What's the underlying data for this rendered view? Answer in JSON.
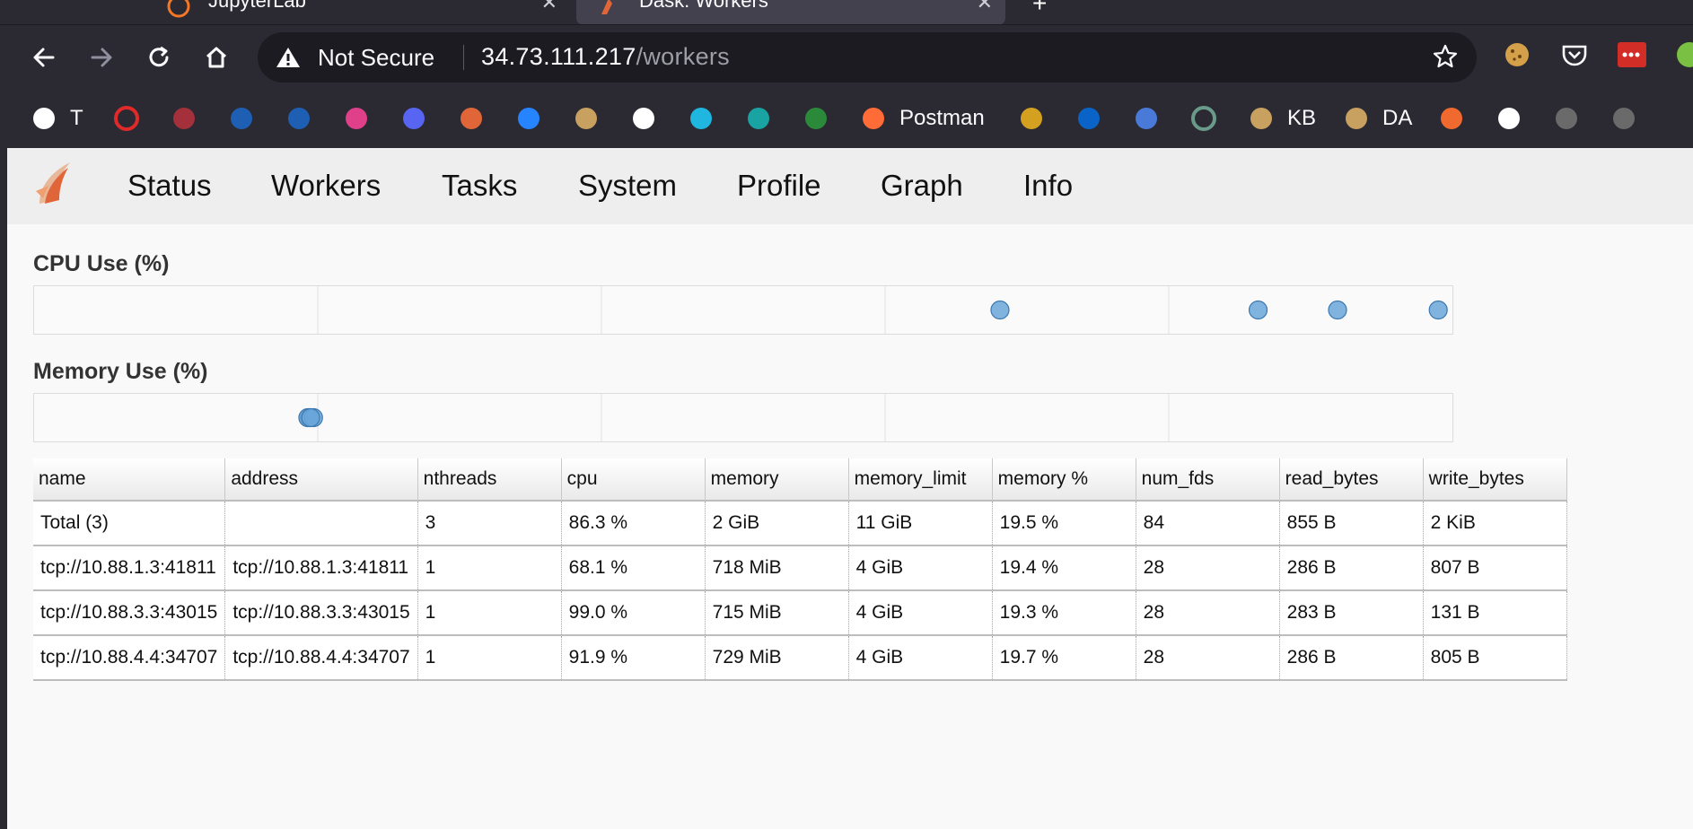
{
  "browser": {
    "tabs": [
      {
        "label": "JupyterLab",
        "close": "✕"
      },
      {
        "label": "Dask: Workers",
        "close": "✕"
      }
    ],
    "new_tab": "+",
    "security": "Not Secure",
    "url_host": "34.73.111.217",
    "url_path": "/workers",
    "bookmarks": [
      {
        "icon": "globe-icon",
        "label": "T",
        "color": "#ffffff"
      },
      {
        "icon": "gear-red-icon",
        "label": "",
        "color": "#e02a2a"
      },
      {
        "icon": "shield-crest-icon",
        "label": "",
        "color": "#a3303a"
      },
      {
        "icon": "ribbon-blue-icon",
        "label": "",
        "color": "#1e5fb3"
      },
      {
        "icon": "ribbon-blue-icon",
        "label": "",
        "color": "#1e5fb3"
      },
      {
        "icon": "heart-icon",
        "label": "",
        "color": "#e0408a"
      },
      {
        "icon": "discord-icon",
        "label": "",
        "color": "#5865f2"
      },
      {
        "icon": "dask-leaf-icon",
        "label": "",
        "color": "#e0663a"
      },
      {
        "icon": "confluence-icon",
        "label": "",
        "color": "#2684ff"
      },
      {
        "icon": "arrow-flag-icon",
        "label": "",
        "color": "#c8a060"
      },
      {
        "icon": "github-icon",
        "label": "",
        "color": "#ffffff"
      },
      {
        "icon": "circle-cyan-icon",
        "label": "",
        "color": "#1fb6e0"
      },
      {
        "icon": "eye-teal-icon",
        "label": "",
        "color": "#1aa3a3"
      },
      {
        "icon": "chart-green-icon",
        "label": "",
        "color": "#2a8a3a"
      },
      {
        "icon": "postman-icon",
        "label": "Postman",
        "color": "#ff6c37"
      },
      {
        "icon": "letter-j-icon",
        "label": "",
        "color": "#d4a020"
      },
      {
        "icon": "outlook-icon",
        "label": "",
        "color": "#0a64c8"
      },
      {
        "icon": "lock-box-icon",
        "label": "",
        "color": "#4a7ad8"
      },
      {
        "icon": "ring-green-icon",
        "label": "",
        "color": "#6a9a8a"
      },
      {
        "icon": "arrow-flag-icon",
        "label": "KB",
        "color": "#c8a060"
      },
      {
        "icon": "arrow-flag-icon",
        "label": "DA",
        "color": "#c8a060"
      },
      {
        "icon": "blocks-orange-icon",
        "label": "",
        "color": "#f06a30"
      },
      {
        "icon": "github-icon",
        "label": "",
        "color": "#ffffff"
      },
      {
        "icon": "github-icon",
        "label": "",
        "color": "#6a6a6a"
      },
      {
        "icon": "github-icon",
        "label": "",
        "color": "#6a6a6a"
      }
    ]
  },
  "dask": {
    "nav": [
      "Status",
      "Workers",
      "Tasks",
      "System",
      "Profile",
      "Graph",
      "Info"
    ],
    "cpu_title": "CPU Use (%)",
    "mem_title": "Memory Use (%)",
    "accent": "#6aa6d8"
  },
  "chart_data": [
    {
      "type": "scatter",
      "title": "CPU Use (%)",
      "xlabel": "",
      "ylabel": "",
      "xlim": [
        0,
        100
      ],
      "grid": true,
      "values": [
        68.1,
        91.9,
        99.0,
        86.3
      ]
    },
    {
      "type": "scatter",
      "title": "Memory Use (%)",
      "xlabel": "",
      "ylabel": "",
      "xlim": [
        0,
        100
      ],
      "grid": true,
      "values": [
        19.4,
        19.3,
        19.7,
        19.5
      ]
    }
  ],
  "table": {
    "columns": [
      "name",
      "address",
      "nthreads",
      "cpu",
      "memory",
      "memory_limit",
      "memory %",
      "num_fds",
      "read_bytes",
      "write_bytes"
    ],
    "rows": [
      [
        "Total (3)",
        "",
        "3",
        "86.3 %",
        "2 GiB",
        "11 GiB",
        "19.5 %",
        "84",
        "855 B",
        "2 KiB"
      ],
      [
        "tcp://10.88.1.3:41811",
        "tcp://10.88.1.3:41811",
        "1",
        "68.1 %",
        "718 MiB",
        "4 GiB",
        "19.4 %",
        "28",
        "286 B",
        "807 B"
      ],
      [
        "tcp://10.88.3.3:43015",
        "tcp://10.88.3.3:43015",
        "1",
        "99.0 %",
        "715 MiB",
        "4 GiB",
        "19.3 %",
        "28",
        "283 B",
        "131 B"
      ],
      [
        "tcp://10.88.4.4:34707",
        "tcp://10.88.4.4:34707",
        "1",
        "91.9 %",
        "729 MiB",
        "4 GiB",
        "19.7 %",
        "28",
        "286 B",
        "805 B"
      ]
    ]
  }
}
